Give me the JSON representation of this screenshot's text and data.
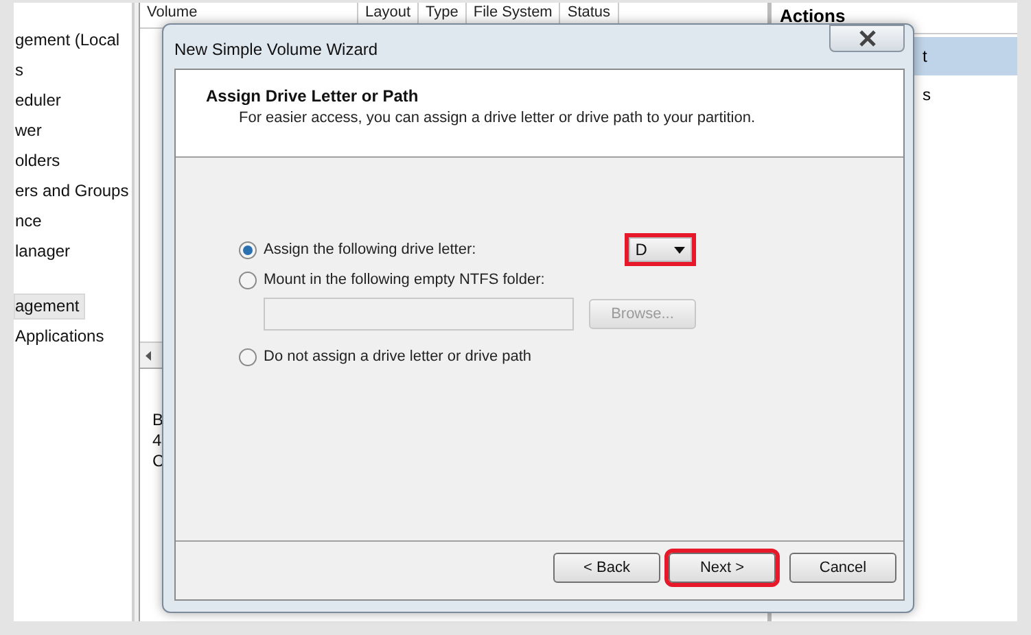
{
  "tree": {
    "items": [
      {
        "label": "gement (Local",
        "selected": false
      },
      {
        "label": "s",
        "selected": false
      },
      {
        "label": "eduler",
        "selected": false
      },
      {
        "label": "wer",
        "selected": false
      },
      {
        "label": "olders",
        "selected": false
      },
      {
        "label": "ers and Groups",
        "selected": false
      },
      {
        "label": "nce",
        "selected": false
      },
      {
        "label": "lanager",
        "selected": false
      },
      {
        "label": "agement",
        "selected": true
      },
      {
        "label": "Applications",
        "selected": false
      }
    ]
  },
  "volume_list": {
    "columns": [
      "Volume",
      "Layout",
      "Type",
      "File System",
      "Status"
    ]
  },
  "disk_pane": {
    "lines": [
      "B",
      "4",
      "C"
    ]
  },
  "actions": {
    "title": "Actions",
    "items": [
      "t",
      "s"
    ]
  },
  "dialog": {
    "title": "New Simple Volume Wizard",
    "heading": "Assign Drive Letter or Path",
    "description": "For easier access, you can assign a drive letter or drive path to your partition.",
    "options": [
      {
        "kind": "letter",
        "label": "Assign the following drive letter:",
        "selected": true
      },
      {
        "kind": "folder",
        "label": "Mount in the following empty NTFS folder:",
        "selected": false
      },
      {
        "kind": "none",
        "label": "Do not assign a drive letter or drive path",
        "selected": false
      }
    ],
    "drive_letter": {
      "value": "D",
      "highlighted": true
    },
    "folder_field": {
      "disabled": true
    },
    "browse_button": {
      "label": "Browse...",
      "disabled": true
    },
    "buttons": [
      {
        "label": "< Back",
        "highlighted": false
      },
      {
        "label": "Next >",
        "highlighted": true
      },
      {
        "label": "Cancel",
        "highlighted": false
      }
    ]
  }
}
